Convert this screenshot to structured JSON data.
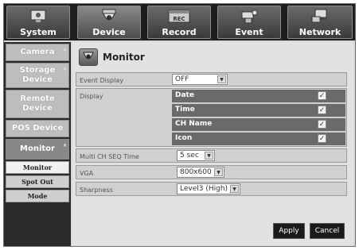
{
  "nav": {
    "tabs": [
      {
        "label": "System",
        "icon": "system-monitor-icon"
      },
      {
        "label": "Device",
        "icon": "camera-dome-icon"
      },
      {
        "label": "Record",
        "icon": "rec-icon",
        "badge": "REC"
      },
      {
        "label": "Event",
        "icon": "event-camera-icon"
      },
      {
        "label": "Network",
        "icon": "network-icon"
      }
    ]
  },
  "sidebar": {
    "items": [
      {
        "label": "Camera"
      },
      {
        "label": "Storage Device"
      },
      {
        "label": "Remote Device"
      },
      {
        "label": "POS Device"
      },
      {
        "label": "Monitor"
      }
    ],
    "subitems": [
      {
        "label": "Monitor"
      },
      {
        "label": "Spot Out"
      },
      {
        "label": "Mode"
      }
    ]
  },
  "content": {
    "title": "Monitor",
    "event_display": {
      "label": "Event Display",
      "value": "OFF"
    },
    "display": {
      "label": "Display",
      "items": [
        {
          "label": "Date",
          "checked": true
        },
        {
          "label": "Time",
          "checked": true
        },
        {
          "label": "CH Name",
          "checked": true
        },
        {
          "label": "Icon",
          "checked": true
        }
      ],
      "check_glyph": "✓"
    },
    "multi_ch_seq": {
      "label": "Multi CH SEQ Time",
      "value": "5 sec"
    },
    "vga": {
      "label": "VGA",
      "value": "800x600"
    },
    "sharpness": {
      "label": "Sharpness",
      "value": "Level3 (High)"
    },
    "apply_label": "Apply",
    "cancel_label": "Cancel"
  },
  "glyphs": {
    "dropdown_arrow": "▼",
    "chevron_down": "»",
    "chevron_up": "«"
  }
}
